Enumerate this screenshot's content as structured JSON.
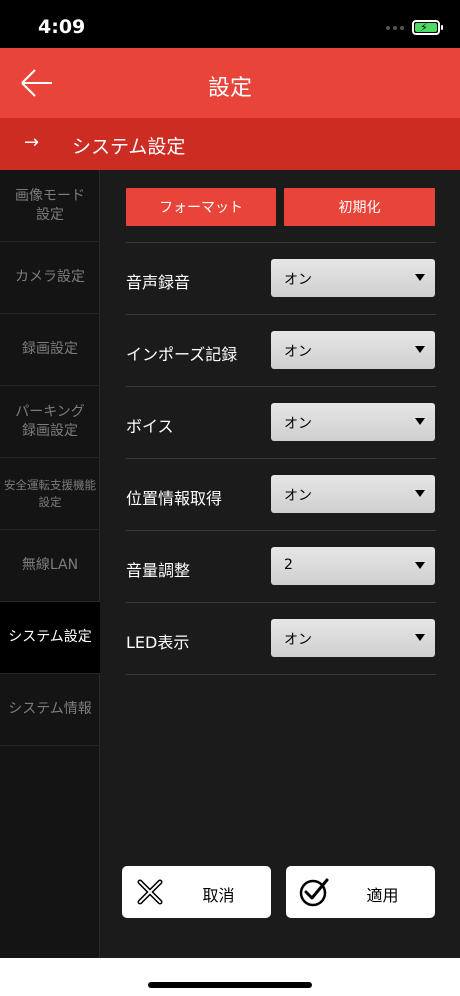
{
  "status": {
    "time": "4:09"
  },
  "nav": {
    "title": "設定"
  },
  "section": {
    "arrow": "→",
    "title": "システム設定"
  },
  "sidebar": {
    "items": [
      {
        "label": "画像モード\n設定"
      },
      {
        "label": "カメラ設定"
      },
      {
        "label": "録画設定"
      },
      {
        "label": "パーキング\n録画設定"
      },
      {
        "label": "安全運転支援機能\n設定"
      },
      {
        "label": "無線LAN"
      },
      {
        "label": "システム設定"
      },
      {
        "label": "システム情報"
      }
    ]
  },
  "actions": {
    "format": "フォーマット",
    "reset": "初期化"
  },
  "settings": [
    {
      "label": "音声録音",
      "value": "オン"
    },
    {
      "label": "インポーズ記録",
      "value": "オン"
    },
    {
      "label": "ボイス",
      "value": "オン"
    },
    {
      "label": "位置情報取得",
      "value": "オン"
    },
    {
      "label": "音量調整",
      "value": "2"
    },
    {
      "label": "LED表示",
      "value": "オン"
    }
  ],
  "footer": {
    "cancel": "取消",
    "apply": "適用"
  },
  "colors": {
    "accent": "#e8443a",
    "section": "#cc2c22",
    "battery": "#4cd964"
  }
}
